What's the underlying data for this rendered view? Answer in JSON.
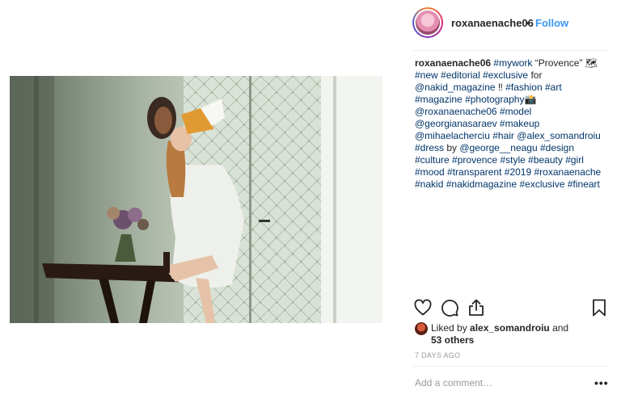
{
  "post": {
    "image_alt": "Editorial photo",
    "author": "roxanaenache06",
    "follow_label": "Follow",
    "separator": "•"
  },
  "caption": {
    "segments": [
      {
        "text": "roxanaenache06",
        "kind": "user"
      },
      {
        "text": " ",
        "kind": "plain"
      },
      {
        "text": "#mywork",
        "kind": "tag"
      },
      {
        "text": " “Provence” 🗺 ",
        "kind": "plain"
      },
      {
        "text": "#new",
        "kind": "tag"
      },
      {
        "text": " ",
        "kind": "plain"
      },
      {
        "text": "#editorial",
        "kind": "tag"
      },
      {
        "text": " ",
        "kind": "plain"
      },
      {
        "text": "#exclusive",
        "kind": "tag"
      },
      {
        "text": " for ",
        "kind": "plain"
      },
      {
        "text": "@nakid_magazine",
        "kind": "mention"
      },
      {
        "text": " ‼ ",
        "kind": "plain"
      },
      {
        "text": "#fashion",
        "kind": "tag"
      },
      {
        "text": " ",
        "kind": "plain"
      },
      {
        "text": "#art",
        "kind": "tag"
      },
      {
        "text": " ",
        "kind": "plain"
      },
      {
        "text": "#magazine",
        "kind": "tag"
      },
      {
        "text": " ",
        "kind": "plain"
      },
      {
        "text": "#photography",
        "kind": "tag"
      },
      {
        "text": "📸 ",
        "kind": "plain"
      },
      {
        "text": "@roxanaenache06",
        "kind": "mention"
      },
      {
        "text": " ",
        "kind": "plain"
      },
      {
        "text": "#model",
        "kind": "tag"
      },
      {
        "text": " ",
        "kind": "plain"
      },
      {
        "text": "@georgianasaraev",
        "kind": "mention"
      },
      {
        "text": " ",
        "kind": "plain"
      },
      {
        "text": "#makeup",
        "kind": "tag"
      },
      {
        "text": " ",
        "kind": "plain"
      },
      {
        "text": "@mihaelacherciu",
        "kind": "mention"
      },
      {
        "text": " ",
        "kind": "plain"
      },
      {
        "text": "#hair",
        "kind": "tag"
      },
      {
        "text": " ",
        "kind": "plain"
      },
      {
        "text": "@alex_somandroiu",
        "kind": "mention"
      },
      {
        "text": " ",
        "kind": "plain"
      },
      {
        "text": "#dress",
        "kind": "tag"
      },
      {
        "text": " by ",
        "kind": "plain"
      },
      {
        "text": "@george__neagu",
        "kind": "mention"
      },
      {
        "text": " ",
        "kind": "plain"
      },
      {
        "text": "#design",
        "kind": "tag"
      },
      {
        "text": " ",
        "kind": "plain"
      },
      {
        "text": "#culture",
        "kind": "tag"
      },
      {
        "text": " ",
        "kind": "plain"
      },
      {
        "text": "#provence",
        "kind": "tag"
      },
      {
        "text": " ",
        "kind": "plain"
      },
      {
        "text": "#style",
        "kind": "tag"
      },
      {
        "text": " ",
        "kind": "plain"
      },
      {
        "text": "#beauty",
        "kind": "tag"
      },
      {
        "text": " ",
        "kind": "plain"
      },
      {
        "text": "#girl",
        "kind": "tag"
      },
      {
        "text": " ",
        "kind": "plain"
      },
      {
        "text": "#mood",
        "kind": "tag"
      },
      {
        "text": " ",
        "kind": "plain"
      },
      {
        "text": "#transparent",
        "kind": "tag"
      },
      {
        "text": " ",
        "kind": "plain"
      },
      {
        "text": "#2019",
        "kind": "tag"
      },
      {
        "text": " ",
        "kind": "plain"
      },
      {
        "text": "#roxanaenache",
        "kind": "tag"
      },
      {
        "text": " ",
        "kind": "plain"
      },
      {
        "text": "#nakid",
        "kind": "tag"
      },
      {
        "text": " ",
        "kind": "plain"
      },
      {
        "text": "#nakidmagazine",
        "kind": "tag"
      },
      {
        "text": " ",
        "kind": "plain"
      },
      {
        "text": "#exclusive",
        "kind": "tag"
      },
      {
        "text": " ",
        "kind": "plain"
      },
      {
        "text": "#fineart",
        "kind": "tag"
      }
    ]
  },
  "actions": {
    "like_icon": "heart-icon",
    "comment_icon": "comment-icon",
    "share_icon": "share-icon",
    "save_icon": "bookmark-icon"
  },
  "likes": {
    "prefix": "Liked by ",
    "user": "alex_somandroiu",
    "suffix": " and",
    "others": "53 others"
  },
  "timestamp": "7 DAYS AGO",
  "comment": {
    "placeholder": "Add a comment…",
    "more_label": "•••"
  },
  "colors": {
    "link": "#003569",
    "follow": "#3897f0",
    "text": "#262626",
    "muted": "#999999"
  }
}
